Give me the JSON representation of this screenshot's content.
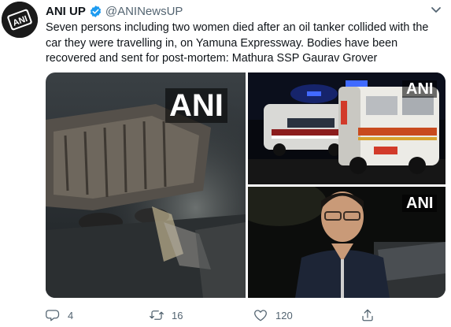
{
  "tweet": {
    "author": {
      "name": "ANI UP",
      "handle": "@ANINewsUP",
      "avatar_text": "ANI",
      "verified_icon": "verified-badge-icon"
    },
    "text": "Seven persons including two women died after an oil tanker collided with the car they were travelling in, on Yamuna Expressway. Bodies have been recovered and sent for post-mortem: Mathura SSP Gaurav Grover",
    "media": [
      {
        "watermark": "ANI",
        "description": "overturned oil tanker at night"
      },
      {
        "watermark": "ANI",
        "description": "ambulances at night"
      },
      {
        "watermark": "ANI",
        "description": "police officer speaking"
      }
    ],
    "actions": {
      "reply": {
        "icon": "reply-icon",
        "count": "4"
      },
      "retweet": {
        "icon": "retweet-icon",
        "count": "16"
      },
      "like": {
        "icon": "heart-icon",
        "count": "120"
      },
      "share": {
        "icon": "share-icon"
      }
    }
  },
  "colors": {
    "text": "#0f1419",
    "secondary": "#536471",
    "verified": "#1d9bf0",
    "background": "#ffffff"
  }
}
